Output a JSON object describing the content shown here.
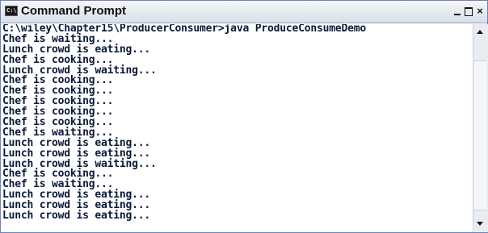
{
  "window": {
    "title": "Command Prompt",
    "icon": "command-prompt-icon",
    "icon_glyph": "C:\\",
    "controls": {
      "minimize": "minimize-icon",
      "maximize": "maximize-icon",
      "close_label": "×"
    }
  },
  "console": {
    "lines": [
      "C:\\wiley\\Chapter15\\ProducerConsumer>java ProduceConsumeDemo",
      "Chef is waiting...",
      "Lunch crowd is eating...",
      "Chef is cooking...",
      "Lunch crowd is waiting...",
      "Chef is cooking...",
      "Chef is cooking...",
      "Chef is cooking...",
      "Chef is cooking...",
      "Chef is cooking...",
      "Chef is waiting...",
      "Lunch crowd is eating...",
      "Lunch crowd is eating...",
      "Lunch crowd is waiting...",
      "Chef is cooking...",
      "Chef is waiting...",
      "Lunch crowd is eating...",
      "Lunch crowd is eating...",
      "Lunch crowd is eating..."
    ]
  },
  "scrollbar": {
    "up_icon": "scroll-up-arrow-icon",
    "down_icon": "scroll-down-arrow-icon"
  }
}
